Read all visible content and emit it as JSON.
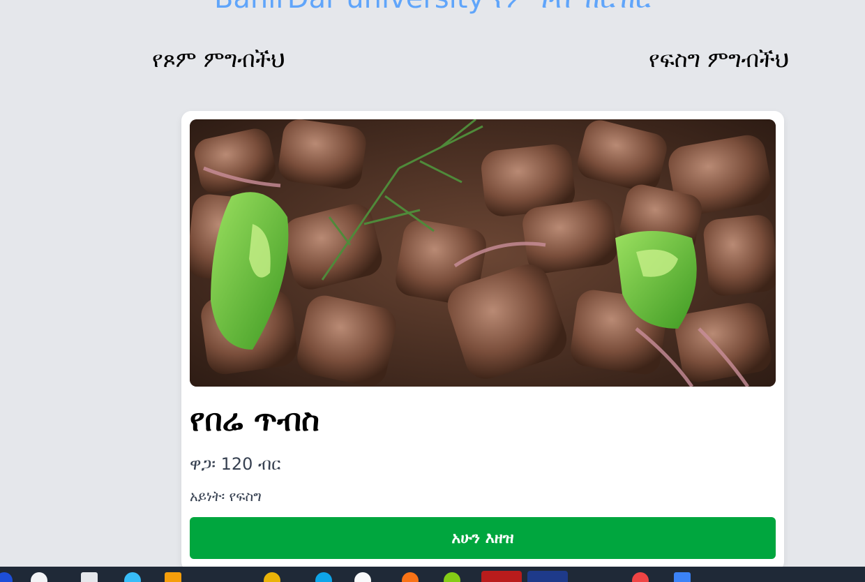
{
  "header": {
    "site_title": "BahirDar university የምግብ ዝርዝር"
  },
  "tabs": [
    {
      "label": "የጾም ምግብችህ"
    },
    {
      "label": "የፍስግ ምግብችህ"
    }
  ],
  "food_card": {
    "name": "የበሬ ጥብስ",
    "price": "ዋጋ፡ 120 ብር",
    "type": "አይነት፡ የፍስግ",
    "order_button_label": "አሁን እዘዝ",
    "image_icon": "food-photo"
  },
  "colors": {
    "background": "#e5e7eb",
    "site_title": "#60a5fa",
    "order_button": "#00a63e",
    "taskbar": "#1f2937"
  }
}
